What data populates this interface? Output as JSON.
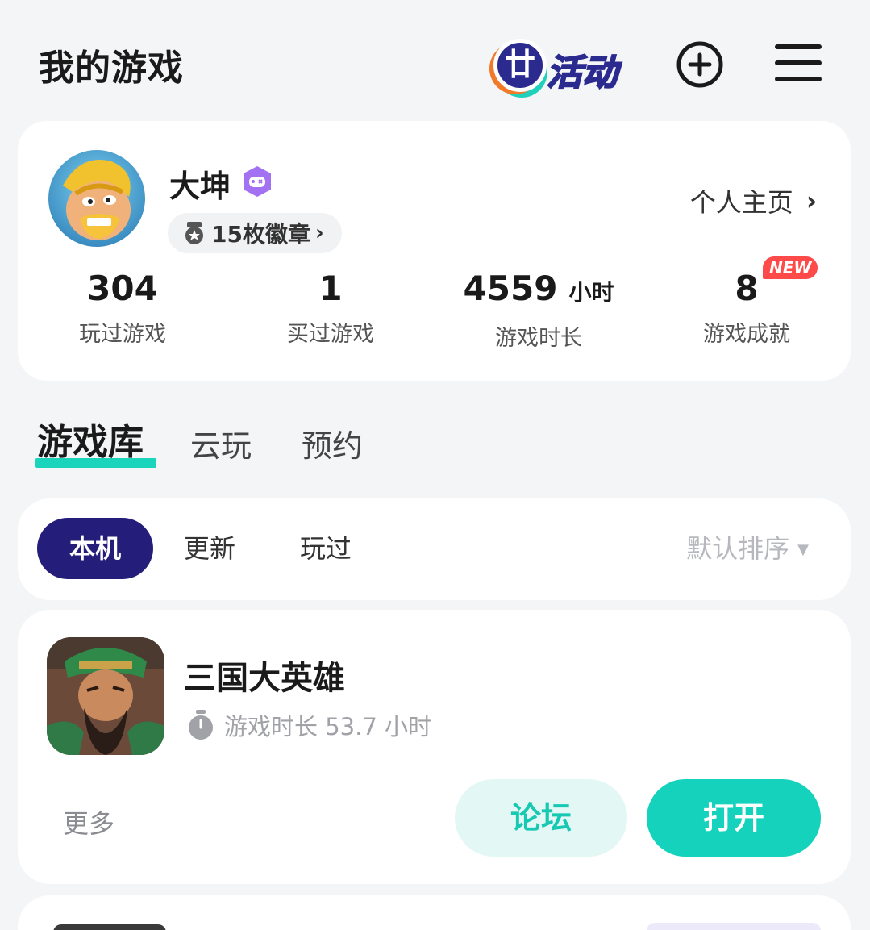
{
  "header": {
    "title": "我的游戏",
    "activity_label": "活动",
    "activity_badge_char": "廿",
    "add_icon": "plus-circle-icon",
    "menu_icon": "hamburger-menu-icon"
  },
  "profile": {
    "username": "大坤",
    "badge_label": "15枚徽章",
    "badge_chevron": "›",
    "homepage_label": "个人主页",
    "homepage_chevron": "›",
    "stats": [
      {
        "value": "304",
        "unit": "",
        "label": "玩过游戏"
      },
      {
        "value": "1",
        "unit": "",
        "label": "买过游戏"
      },
      {
        "value": "4559",
        "unit": "小时",
        "label": "游戏时长"
      },
      {
        "value": "8",
        "unit": "",
        "label": "游戏成就",
        "badge": "NEW"
      }
    ]
  },
  "tabs": {
    "items": [
      "游戏库",
      "云玩",
      "预约"
    ],
    "active": "游戏库"
  },
  "filters": {
    "items": [
      "本机",
      "更新",
      "玩过"
    ],
    "active": "本机",
    "sort_label": "默认排序",
    "sort_caret": "▼"
  },
  "game": {
    "name": "三国大英雄",
    "playtime_text": "游戏时长 53.7 小时",
    "more_label": "更多",
    "forum_label": "论坛",
    "open_label": "打开"
  },
  "colors": {
    "accent_teal": "#14d2bb",
    "brand_navy": "#241e7a",
    "new_badge_red": "#ff4a4a",
    "background": "#f4f5f7"
  }
}
